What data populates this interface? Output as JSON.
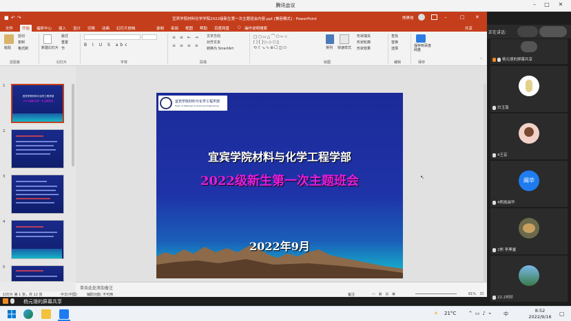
{
  "window": {
    "title": "腾讯会议"
  },
  "ppt": {
    "doc_title": "宜宾学院材料化学学院2022级新生第一次主题班会内容.ppt [兼容模式] - PowerPoint",
    "user": "熊黑哥",
    "tabs": [
      "文件",
      "开始",
      "福昕中心",
      "插入",
      "设计",
      "切换",
      "动画",
      "幻灯片放映",
      "录制",
      "审阅",
      "视图",
      "帮助",
      "百度网盘",
      "操作说明搜索"
    ],
    "share_label": "共享",
    "ribbon": {
      "paste": "粘贴",
      "cut": "剪切",
      "copy": "复制",
      "format_painter": "格式刷",
      "clipboard": "剪贴板",
      "new_slide": "新建幻灯片",
      "layout": "版式",
      "reset": "重置",
      "section": "节",
      "slides": "幻灯片",
      "font": "字体",
      "paragraph": "段落",
      "text_direction": "文字方向",
      "align_text": "对齐文本",
      "smartart": "转换为 SmartArt",
      "drawing": "绘图",
      "arrange": "排列",
      "quick_styles": "快速样式",
      "shape_fill": "形状填充",
      "shape_outline": "形状轮廓",
      "shape_effects": "形状效果",
      "find": "查找",
      "replace": "替换",
      "select": "选择",
      "editing": "编辑",
      "save_baidu": "保存到百度网盘",
      "save": "保存"
    }
  },
  "thumbnails": [
    {
      "num": "1",
      "title": "宜宾学院材料与化学工程学部",
      "subtitle": "2022级新生第一次主题班会"
    },
    {
      "num": "2"
    },
    {
      "num": "3"
    },
    {
      "num": "4"
    },
    {
      "num": "5"
    }
  ],
  "slide": {
    "logo_text": "宜宾学院材料与化学工程学部",
    "logo_sub": "Dept. of Materials & Chemical Engineering",
    "line1": "宜宾学院材料与化学工程学部",
    "line2": "2022级新生第一次主题班会",
    "date": "2022年9月",
    "line2_color": "#e21ee0"
  },
  "notes_placeholder": "单击此处添加备注",
  "statusbar": {
    "slide_info": "幻灯片 第 1 张，共 12 张",
    "lang": "中文(中国)",
    "accessibility": "辅助功能: 不可用",
    "notes": "备注",
    "zoom": "81%"
  },
  "meeting": {
    "speaking_label": "正在讲话:",
    "sharing_text": "杨元璟的屏幕共享",
    "participants": [
      {
        "name": "杨元璟的屏幕共享"
      },
      {
        "name": "白玉藻"
      },
      {
        "name": "4王芸"
      },
      {
        "name": "4熊胤闽华",
        "avatar_text": "闽华"
      },
      {
        "name": "2熊 李黑馨"
      },
      {
        "name": "22.2刘珍"
      }
    ]
  },
  "taskbar": {
    "temp": "21°C",
    "time": "8:52",
    "date": "2022/9/16"
  },
  "colors": {
    "ppt_red": "#c43e1c",
    "slide_bg": "#1c2a9a",
    "avatar_blue": "#1e7cf0"
  }
}
